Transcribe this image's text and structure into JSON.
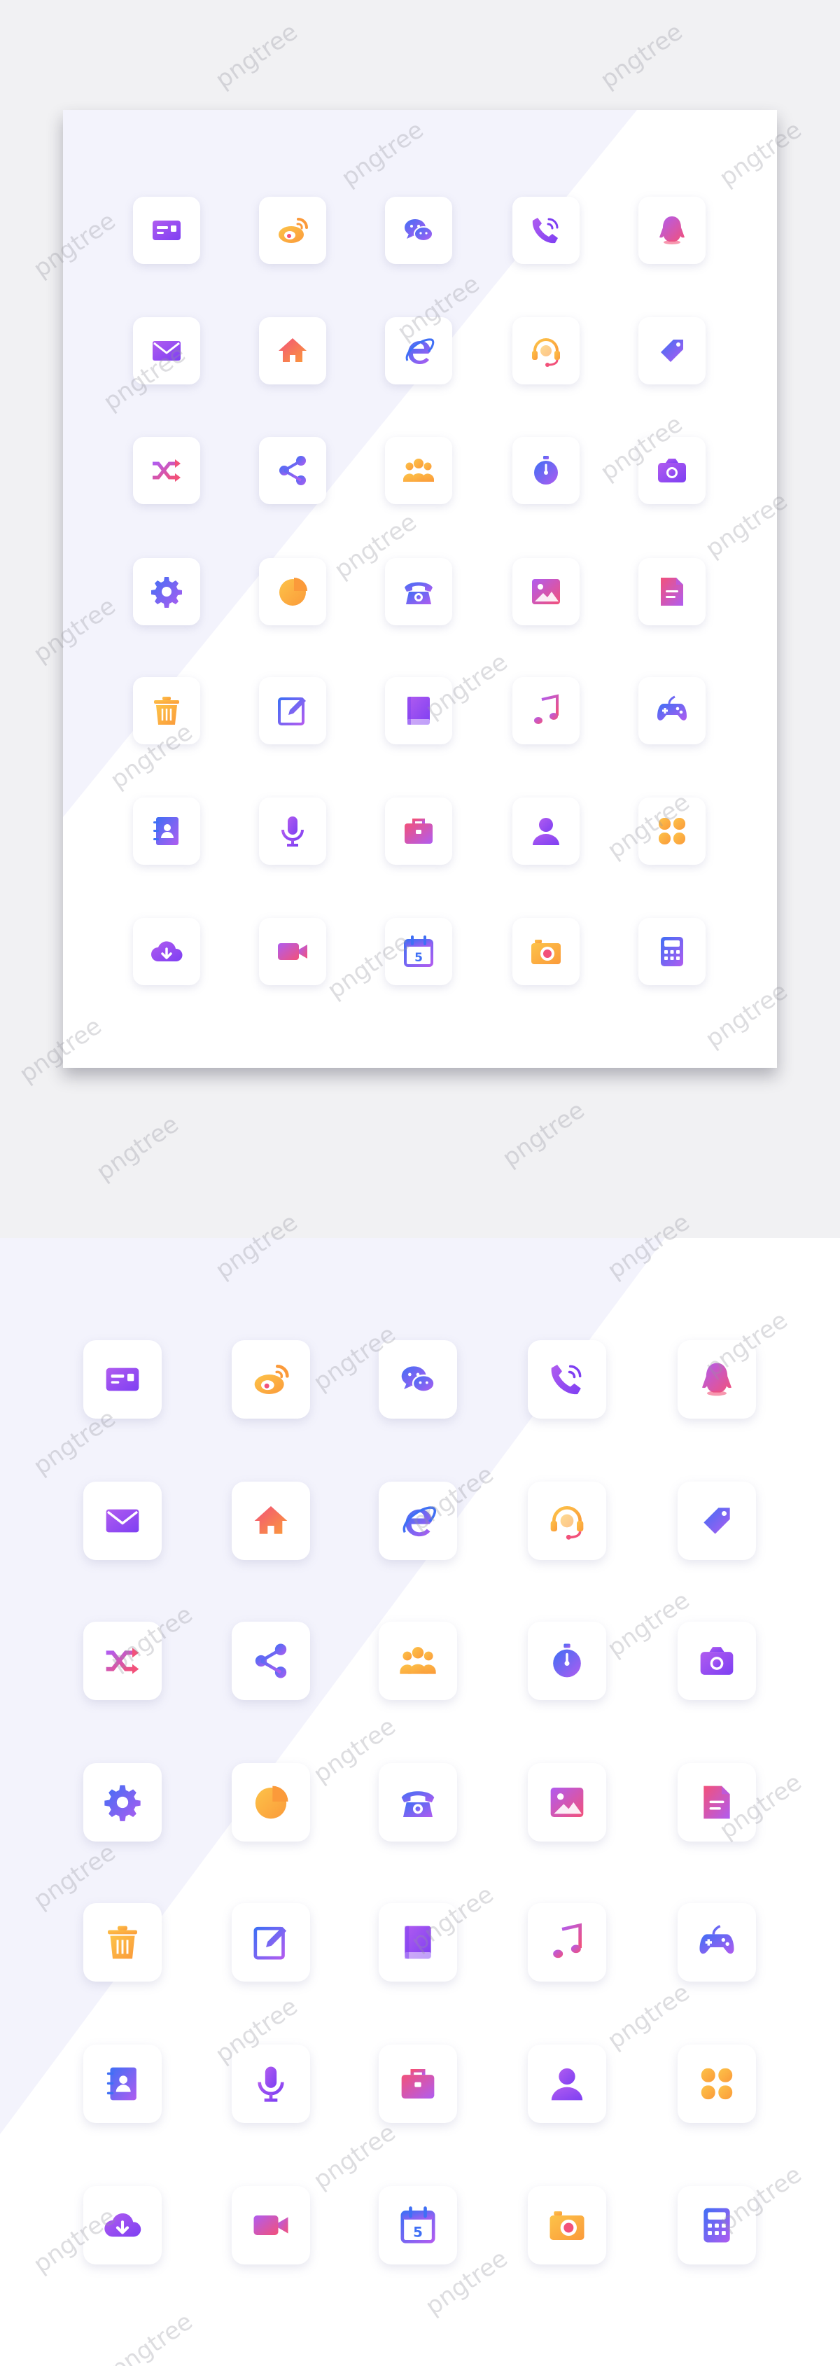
{
  "colors": {
    "purple": "#7e3ff2",
    "violet": "#b05cf0",
    "pink": "#f2517a",
    "orange": "#fb9a3a",
    "yellow": "#fcc349",
    "blue": "#3f6ff5",
    "page_bg": "#f1f1f3",
    "panel_tint": "#f3f3fc"
  },
  "icons": [
    "id-card-icon",
    "weibo-icon",
    "wechat-icon",
    "phone-call-icon",
    "qq-penguin-icon",
    "mail-icon",
    "home-icon",
    "ie-browser-icon",
    "headset-icon",
    "tag-icon",
    "shuffle-icon",
    "share-icon",
    "group-icon",
    "stopwatch-icon",
    "camera-icon",
    "settings-gear-icon",
    "pie-chart-icon",
    "telephone-icon",
    "image-icon",
    "document-icon",
    "trash-icon",
    "edit-icon",
    "book-icon",
    "music-icon",
    "gamepad-icon",
    "contacts-icon",
    "microphone-icon",
    "briefcase-icon",
    "user-icon",
    "apps-clover-icon",
    "cloud-download-icon",
    "video-camera-icon",
    "calendar-icon",
    "photo-camera-icon",
    "calculator-icon"
  ],
  "calendar_day": "5",
  "watermark_text": "pngtree"
}
